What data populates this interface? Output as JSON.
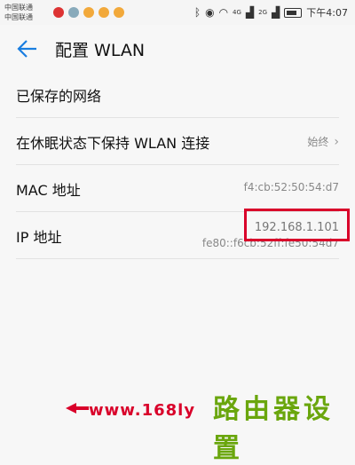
{
  "status_bar": {
    "carrier1": "中国联通",
    "carrier2": "中国联通",
    "signal1": "4G",
    "signal2": "2G",
    "time": "下午4:07"
  },
  "header": {
    "title": "配置 WLAN"
  },
  "list": {
    "saved_networks": "已保存的网络",
    "keep_wlan_label": "在休眠状态下保持 WLAN 连接",
    "keep_wlan_value": "始终",
    "mac_label": "MAC 地址",
    "mac_value": "f4:cb:52:50:54:d7",
    "ip_label": "IP 地址",
    "ipv4_value": "192.168.1.101",
    "ipv6_value": "fe80::f6cb:52ff:fe50:54d7"
  },
  "watermark": {
    "url": "www.168ly",
    "brand": "路由器设置"
  },
  "colors": {
    "accent": "#1a7ee0",
    "highlight": "#d9002a",
    "brand_green": "#6aa60d"
  }
}
